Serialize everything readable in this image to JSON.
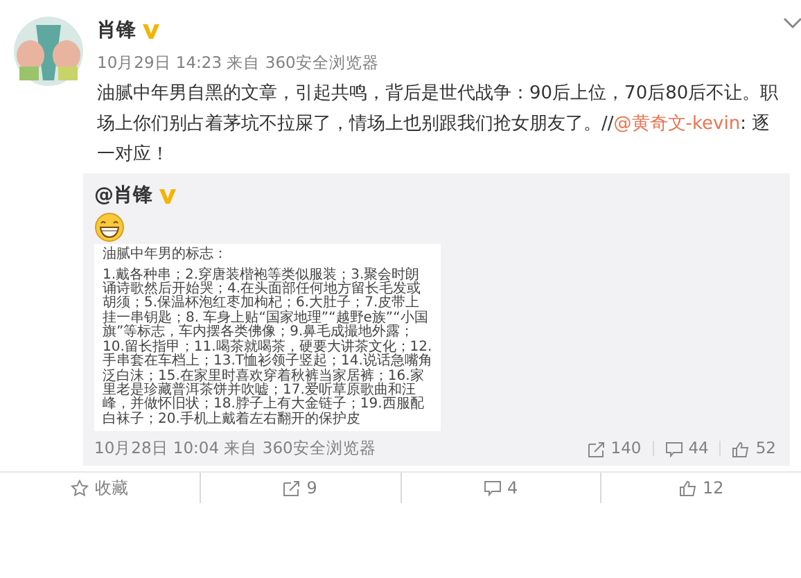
{
  "post": {
    "author": "肖锋",
    "verified": true,
    "meta": "10月29日 14:23 来自 360安全浏览器",
    "text": "油腻中年男自黑的文章，引起共鸣，背后是世代战争：90后上位，70后80后不让。职场上你们别占着茅坑不拉屎了，情场上也别跟我们抢女朋友了。//",
    "mention": "@黄奇文-kevin",
    "text_after": ": 逐一对应！"
  },
  "retweet": {
    "author": "@肖锋",
    "verified": true,
    "emoji": true,
    "image": {
      "title": "油腻中年男的标志：",
      "body": "1.戴各种串；2.穿唐装楷袍等类似服装；3.聚会时朗诵诗歌然后开始哭；4.在头面部任何地方留长毛发或胡须；5.保温杯泡红枣加枸杞；6.大肚子；7.皮带上挂一串钥匙；8. 车身上贴“国家地理”“越野e族”“小国旗”等标志，车内摆各类佛像；9.鼻毛成撮地外露；10.留长指甲；11.喝茶就喝茶，硬要大讲茶文化；12.手串套在车档上；13.T恤衫领子竖起；14.说话急嘴角泛白沫；15.在家里时喜欢穿着秋裤当家居裤；16.家里老是珍藏普洱茶饼并吹嘘；17.爱听草原歌曲和汪峰，并做怀旧状；18.脖子上有大金链子；19.西服配白袜子；20.手机上戴着左右翻开的保护皮"
    },
    "meta": "10月28日 10:04 来自 360安全浏览器",
    "stats": [
      {
        "kind": "repost",
        "count": "140"
      },
      {
        "kind": "comment",
        "count": "44"
      },
      {
        "kind": "like",
        "count": "52"
      }
    ]
  },
  "actions": [
    {
      "kind": "favorite",
      "label": "收藏"
    },
    {
      "kind": "repost",
      "label": "9"
    },
    {
      "kind": "comment",
      "label": "4"
    },
    {
      "kind": "like",
      "label": "12"
    }
  ]
}
